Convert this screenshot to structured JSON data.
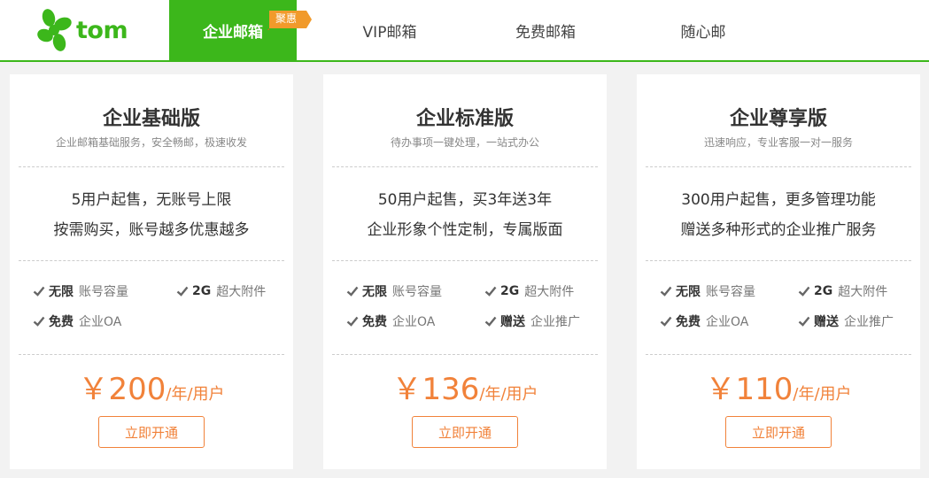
{
  "header": {
    "logo_text": "tom",
    "nav": [
      {
        "label": "企业邮箱",
        "active": true
      },
      {
        "label": "VIP邮箱",
        "active": false
      },
      {
        "label": "免费邮箱",
        "active": false
      },
      {
        "label": "随心邮",
        "active": false
      }
    ],
    "badge": "聚惠"
  },
  "colors": {
    "brand_green": "#3cb71b",
    "accent_orange": "#f1823a"
  },
  "plans": [
    {
      "title": "企业基础版",
      "subtitle": "企业邮箱基础服务，安全畅邮，极速收发",
      "desc_lines": [
        "5用户起售，无账号上限",
        "按需购买，账号越多优惠越多"
      ],
      "features": [
        {
          "key": "无限",
          "value": "账号容量"
        },
        {
          "key": "2G",
          "value": "超大附件"
        },
        {
          "key": "免费",
          "value": "企业OA"
        }
      ],
      "price_symbol": "￥",
      "price": "200",
      "price_unit": "/年/用户",
      "button": "立即开通"
    },
    {
      "title": "企业标准版",
      "subtitle": "待办事项一键处理，一站式办公",
      "desc_lines": [
        "50用户起售，买3年送3年",
        "企业形象个性定制，专属版面"
      ],
      "features": [
        {
          "key": "无限",
          "value": "账号容量"
        },
        {
          "key": "2G",
          "value": "超大附件"
        },
        {
          "key": "免费",
          "value": "企业OA"
        },
        {
          "key": "赠送",
          "value": "企业推广"
        }
      ],
      "price_symbol": "￥",
      "price": "136",
      "price_unit": "/年/用户",
      "button": "立即开通"
    },
    {
      "title": "企业尊享版",
      "subtitle": "迅速响应，专业客服一对一服务",
      "desc_lines": [
        "300用户起售，更多管理功能",
        "赠送多种形式的企业推广服务"
      ],
      "features": [
        {
          "key": "无限",
          "value": "账号容量"
        },
        {
          "key": "2G",
          "value": "超大附件"
        },
        {
          "key": "免费",
          "value": "企业OA"
        },
        {
          "key": "赠送",
          "value": "企业推广"
        }
      ],
      "price_symbol": "￥",
      "price": "110",
      "price_unit": "/年/用户",
      "button": "立即开通"
    }
  ]
}
